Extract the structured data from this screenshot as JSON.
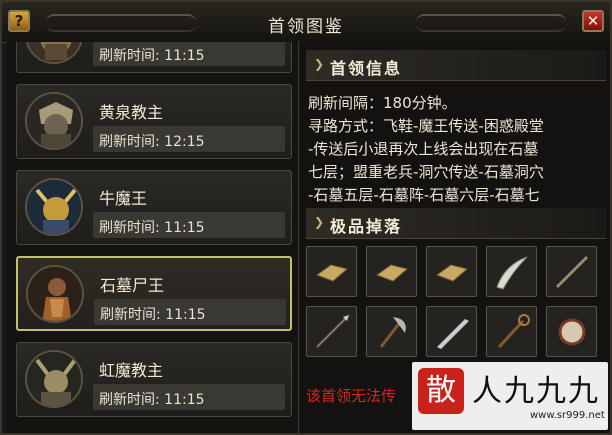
{
  "window": {
    "title": "首领图鉴",
    "help_label": "?",
    "close_label": "✕"
  },
  "boss_list": [
    {
      "name": "",
      "time_label": "刷新时间: 11:15",
      "selected": false,
      "icon": "boss-portrait"
    },
    {
      "name": "黄泉教主",
      "time_label": "刷新时间: 12:15",
      "selected": false,
      "icon": "boss-portrait"
    },
    {
      "name": "牛魔王",
      "time_label": "刷新时间: 11:15",
      "selected": false,
      "icon": "boss-portrait"
    },
    {
      "name": "石墓尸王",
      "time_label": "刷新时间: 11:15",
      "selected": true,
      "icon": "boss-portrait"
    },
    {
      "name": "虹魔教主",
      "time_label": "刷新时间: 11:15",
      "selected": false,
      "icon": "boss-portrait"
    }
  ],
  "info": {
    "section_title": "首领信息",
    "lines": [
      "刷新间隔：180分钟。",
      "寻路方式：飞鞋-魔王传送-困惑殿堂",
      "-传送后小退再次上线会出现在石墓",
      "七层；盟重老兵-洞穴传送-石墓洞穴",
      "-石墓五层-石墓阵-石墓六层-石墓七"
    ]
  },
  "drops": {
    "section_title": "极品掉落",
    "items": [
      "scroll-icon",
      "scroll-icon",
      "scroll-icon",
      "sabre-icon",
      "sword-icon",
      "spear-icon",
      "axe-icon",
      "blade-icon",
      "staff-icon",
      "orb-icon"
    ]
  },
  "warning": "该首领无法传",
  "watermark": {
    "seal": "散",
    "text": "人九九九",
    "url": "www.sr999.net"
  },
  "colors": {
    "accent": "#c5c06d",
    "warning": "#d8261c"
  }
}
